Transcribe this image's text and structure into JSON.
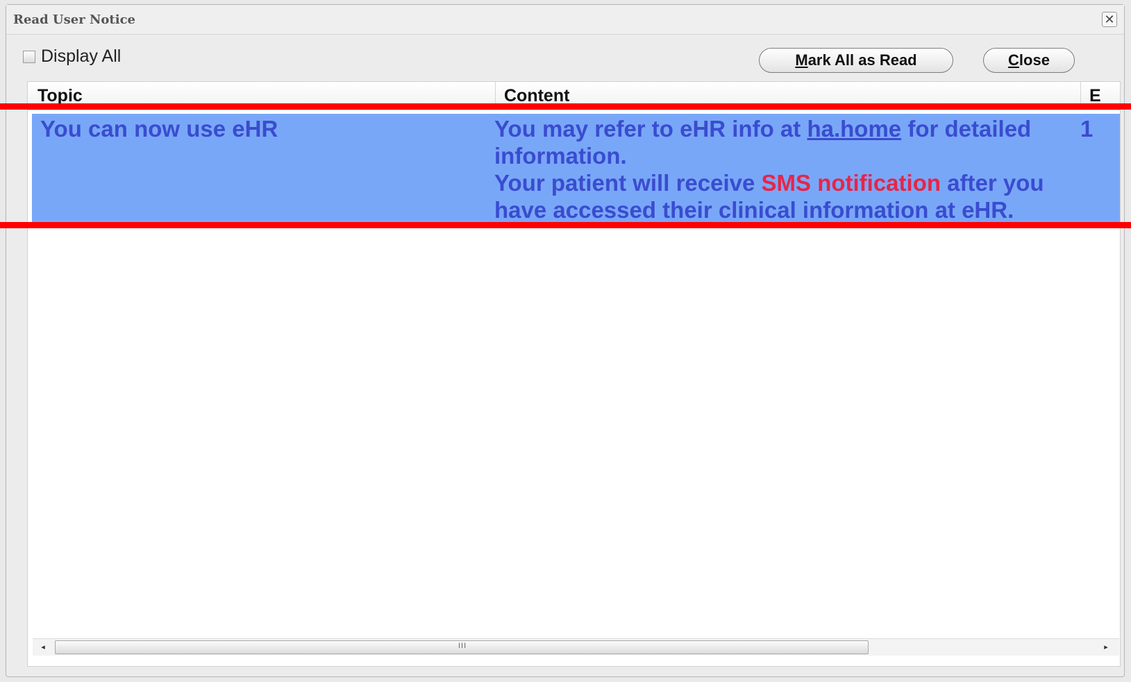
{
  "window": {
    "title": "Read User Notice",
    "close_glyph": "✕"
  },
  "toolbar": {
    "display_all_label": "Display All",
    "display_all_checked": false,
    "mark_all_button": {
      "mnemonic": "M",
      "rest": "ark All as Read"
    },
    "close_button": {
      "mnemonic": "C",
      "rest": "lose"
    }
  },
  "table": {
    "headers": {
      "topic": "Topic",
      "content": "Content",
      "extra": "E"
    },
    "rows": [
      {
        "topic": "You can now use eHR",
        "content": {
          "part1": "You may refer to eHR info at ",
          "link": "ha.home",
          "part2": " for detailed information.",
          "part3": "Your patient will receive ",
          "highlight": "SMS notification",
          "part4": " after you have accessed their clinical information at eHR."
        },
        "extra": "1"
      }
    ]
  },
  "scrollbar": {
    "left_arrow": "◂",
    "right_arrow": "▸",
    "grip": "III"
  },
  "colors": {
    "selected_row_bg": "#79a7f8",
    "row_text": "#3a4ccf",
    "sms_text": "#e4264a",
    "annotation": "#ff0000"
  }
}
